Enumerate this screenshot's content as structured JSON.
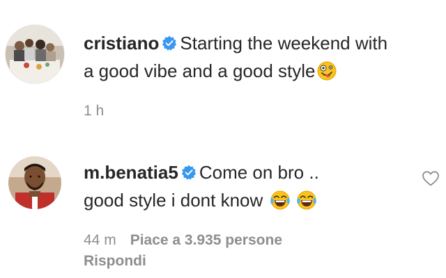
{
  "caption": {
    "username": "cristiano",
    "text_line1": "Starting the weekend with",
    "text_line2": "a good vibe and a good style",
    "time": "1 h",
    "emoji": "zany-face"
  },
  "comment": {
    "username": "m.benatia5",
    "text_line1": "Come on bro ..",
    "text_line2": "good style i dont know",
    "time": "44 m",
    "likes": "Piace a 3.935 persone",
    "reply": "Rispondi",
    "emojis": [
      "tears-of-joy",
      "tears-of-joy"
    ]
  },
  "colors": {
    "text": "#262626",
    "meta": "#8e8e8e",
    "verified": "#3897f0"
  }
}
